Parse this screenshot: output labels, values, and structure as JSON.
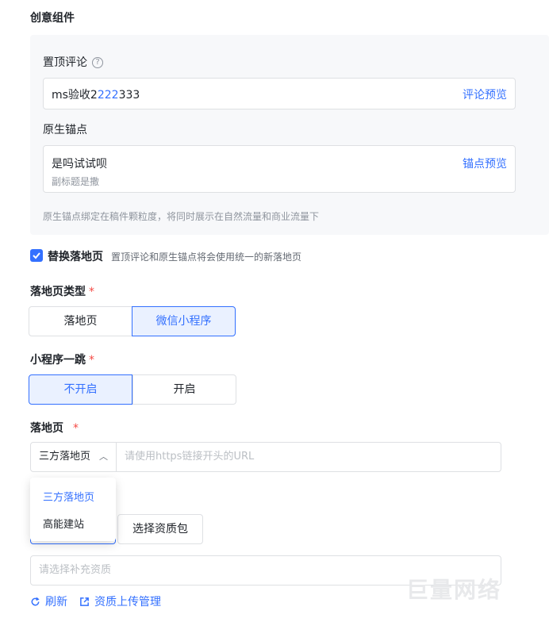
{
  "section": {
    "title": "创意组件"
  },
  "pinned_comment": {
    "label": "置顶评论",
    "help_icon": "question-circle-icon",
    "value_prefix": "ms验收2",
    "value_highlight": "222",
    "value_suffix": "333",
    "preview_label": "评论预览"
  },
  "native_anchor": {
    "label": "原生锚点",
    "title": "是吗试试呗",
    "subtitle": "副标题是撒",
    "preview_label": "锚点预览",
    "hint": "原生锚点绑定在稿件颗粒度，将同时展示在自然流量和商业流量下"
  },
  "replace_landing": {
    "checked": true,
    "label": "替换落地页",
    "hint": "置顶评论和原生锚点将会使用统一的新落地页"
  },
  "landing_type": {
    "label": "落地页类型",
    "required_mark": "*",
    "options": [
      "落地页",
      "微信小程序"
    ],
    "selected": "微信小程序"
  },
  "mini_program_jump": {
    "label": "小程序一跳",
    "required_mark": "*",
    "options": [
      "不开启",
      "开启"
    ],
    "selected": "不开启"
  },
  "landing_page": {
    "label": "落地页",
    "required_mark": "*",
    "select_value": "三方落地页",
    "chevron_icon": "chevron-up-icon",
    "url_placeholder": "请使用https链接开头的URL",
    "dropdown_options": [
      "三方落地页",
      "高能建站"
    ],
    "dropdown_selected": "三方落地页"
  },
  "qualification": {
    "pack_button": "选择资质包",
    "placeholder": "请选择补充资质",
    "refresh_label": "刷新",
    "refresh_icon": "refresh-icon",
    "upload_label": "资质上传管理",
    "upload_icon": "external-link-icon"
  },
  "watermark": "巨量网络",
  "colors": {
    "accent": "#3370ff",
    "required": "#f54a45",
    "panel": "#f7f8fa"
  }
}
